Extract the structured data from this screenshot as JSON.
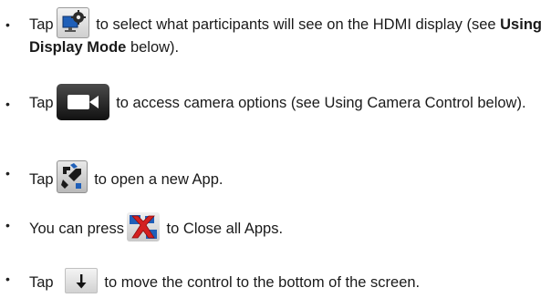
{
  "bullet_char": "•",
  "items": [
    {
      "pre": "Tap",
      "post_1": " to select what participants will see on the HDMI display (see ",
      "bold": "Using Display Mode",
      "post_2": " below).",
      "icon": "display-settings-icon"
    },
    {
      "pre": "Tap",
      "post_1": " to access camera options (see Using Camera Control below).",
      "icon": "camera-icon"
    },
    {
      "pre": "Tap",
      "post_1": " to open a new App.",
      "icon": "app-icon"
    },
    {
      "pre": "You can press",
      "post_1": " to Close all Apps.",
      "icon": "close-all-apps-icon"
    },
    {
      "pre": "Tap",
      "post_1": "  to move the control to the bottom of the screen.",
      "icon": "arrow-down-icon"
    }
  ],
  "colors": {
    "text": "#1a1a1a",
    "icon_accent_blue": "#1f5fb8",
    "icon_accent_red": "#d42020",
    "camera_bg": "#1b1b1b"
  }
}
